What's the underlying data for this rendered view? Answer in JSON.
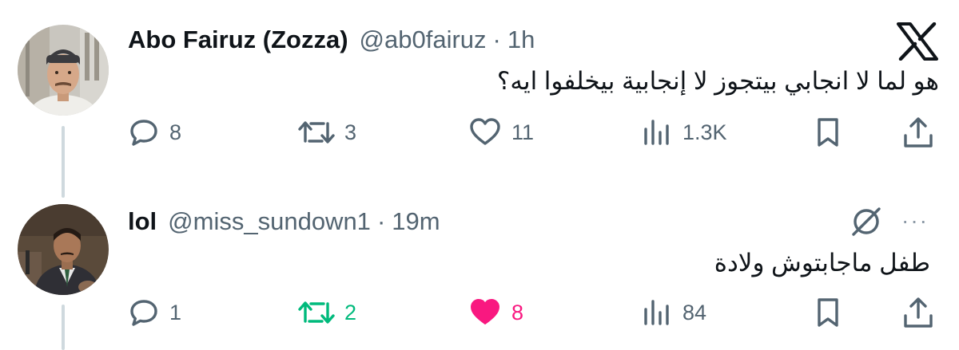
{
  "brand_icon": "x-logo-icon",
  "tweets": [
    {
      "author_name": "Abo Fairuz (Zozza)",
      "handle": "@ab0fairuz",
      "separator": "·",
      "time": "1h",
      "text": "هو لما لا انجابي بيتجوز لا إنجابية بيخلفوا ايه؟",
      "actions": {
        "replies": "8",
        "retweets": "3",
        "likes": "11",
        "views": "1.3K"
      }
    },
    {
      "author_name": "lol",
      "handle": "@miss_sundown1",
      "separator": "·",
      "time": "19m",
      "text": "طفل ماجابتوش ولادة",
      "more_label": "···",
      "actions": {
        "replies": "1",
        "retweets": "2",
        "likes": "8",
        "views": "84"
      }
    }
  ],
  "colors": {
    "text_primary": "#0f1419",
    "text_secondary": "#536471",
    "retweet_active": "#00ba7c",
    "like_active": "#f91880",
    "thread_line": "#cfd9de"
  }
}
